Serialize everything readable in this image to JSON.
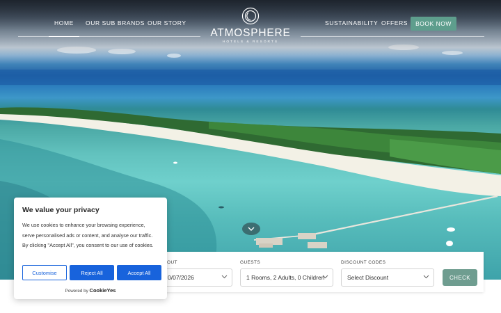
{
  "nav": {
    "home": "HOME",
    "sub_brands": "OUR SUB BRANDS",
    "story": "OUR STORY",
    "sustainability": "SUSTAINABILITY",
    "offers": "OFFERS",
    "book_now": "BOOK NOW"
  },
  "logo": {
    "name": "ATMOSPHERE",
    "tagline": "HOTELS & RESORTS",
    "icon": "atmosphere-ring-logo-icon"
  },
  "booking": {
    "checkout_label_partial": "OUT",
    "checkout_value": "0/07/2026",
    "guests_label": "GUESTS",
    "guests_value": "1 Rooms, 2 Adults, 0 Children",
    "discount_label": "DISCOUNT CODES",
    "discount_value": "Select Discount",
    "check_label": "CHECK"
  },
  "cookie": {
    "title": "We value your privacy",
    "text": "We use cookies to enhance your browsing experience, serve personalised ads or content, and analyse our traffic. By clicking \"Accept All\", you consent to our use of cookies.",
    "customise": "Customise",
    "reject": "Reject All",
    "accept": "Accept All",
    "powered_by": "Powered by",
    "brand": "CookieYes"
  },
  "colors": {
    "accent_green": "#5e9e8d",
    "check_green": "#6f9d90",
    "cookie_blue": "#1863dc"
  },
  "icons": [
    "chevron-down-icon",
    "scroll-down-chevron-icon",
    "atmosphere-ring-logo-icon"
  ]
}
